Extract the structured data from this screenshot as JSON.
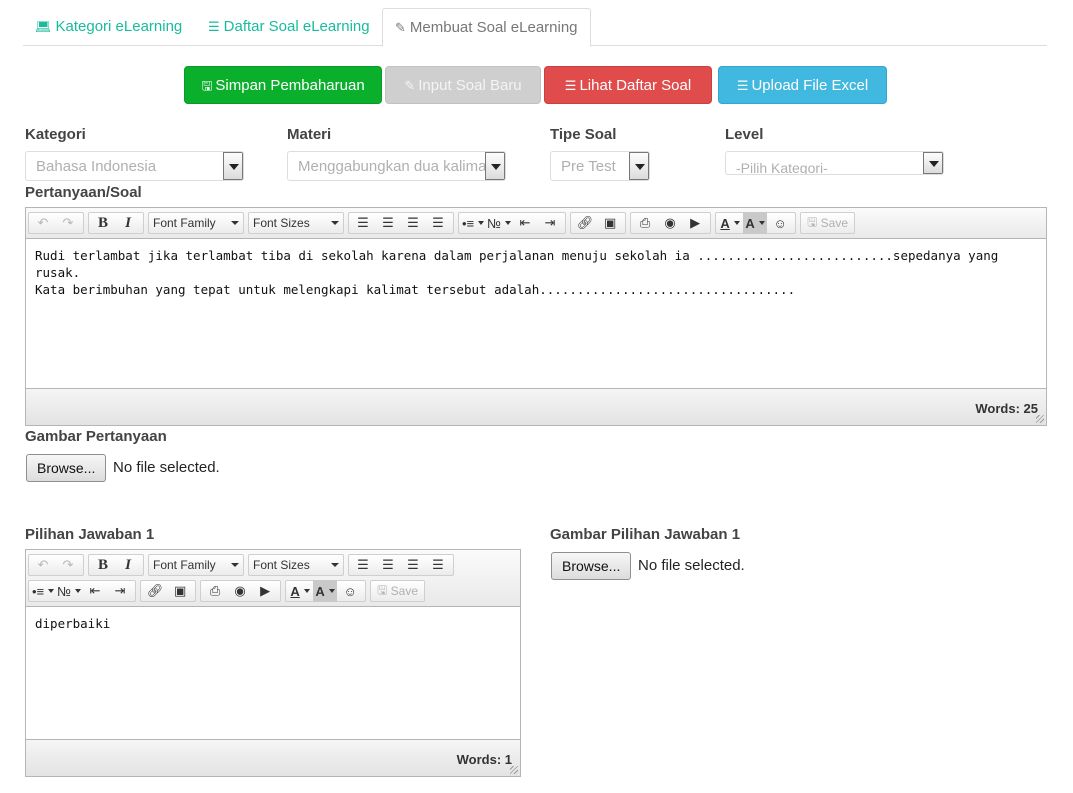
{
  "tabs": [
    {
      "label": "Kategori eLearning",
      "icon": "laptop-icon"
    },
    {
      "label": "Daftar Soal eLearning",
      "icon": "list-icon"
    },
    {
      "label": "Membuat Soal eLearning",
      "icon": "pencil-icon"
    }
  ],
  "actions": {
    "save": "Simpan Pembaharuan",
    "new": "Input Soal Baru",
    "list": "Lihat Daftar Soal",
    "upload": "Upload File Excel"
  },
  "form": {
    "kategori": {
      "label": "Kategori",
      "value": "Bahasa Indonesia"
    },
    "materi": {
      "label": "Materi",
      "value": "Menggabungkan dua kalima"
    },
    "tipe": {
      "label": "Tipe Soal",
      "value": "Pre Test"
    },
    "level": {
      "label": "Level",
      "value": "-Pilih Kategori-"
    }
  },
  "toolbar": {
    "font_family": "Font Family",
    "font_sizes": "Font Sizes",
    "save": "Save"
  },
  "question": {
    "label": "Pertanyaan/Soal",
    "content": "Rudi terlambat jika terlambat tiba di sekolah karena dalam perjalanan menuju sekolah ia ..........................sepedanya yang rusak.\nKata berimbuhan yang tepat untuk melengkapi kalimat tersebut adalah..................................",
    "words": "Words: 25"
  },
  "question_image": {
    "label": "Gambar Pertanyaan",
    "browse": "Browse...",
    "status": "No file selected."
  },
  "answer1": {
    "label": "Pilihan Jawaban 1",
    "content": "diperbaiki",
    "words": "Words: 1"
  },
  "answer1_image": {
    "label": "Gambar Pilihan Jawaban 1",
    "browse": "Browse...",
    "status": "No file selected."
  }
}
